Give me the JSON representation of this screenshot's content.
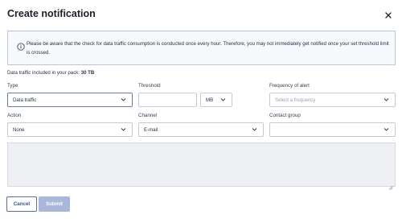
{
  "dialog": {
    "title": "Create notification"
  },
  "notice": {
    "icon": "info-icon",
    "text": "Please be aware that the check for data traffic consumption is conducted once every hour. Therefore, you may not immediately get notified once your set threshold limit is crossed."
  },
  "quota": {
    "prefix": "Data traffic included in your pack:",
    "value": "30 TB"
  },
  "form": {
    "type": {
      "label": "Type",
      "value": "Data traffic"
    },
    "threshold": {
      "label": "Threshold",
      "value": "",
      "unit": "MB"
    },
    "frequency": {
      "label": "Frequency of alert",
      "placeholder": "Select a frequency"
    },
    "action": {
      "label": "Action",
      "value": "None"
    },
    "channel": {
      "label": "Channel",
      "value": "E-mail"
    },
    "contact_group": {
      "label": "Contact group",
      "value": ""
    },
    "message": {
      "value": ""
    }
  },
  "buttons": {
    "cancel": "Cancel",
    "submit": "Submit"
  },
  "colors": {
    "accent": "#3a5590",
    "submit_disabled": "#a9b8d8"
  }
}
